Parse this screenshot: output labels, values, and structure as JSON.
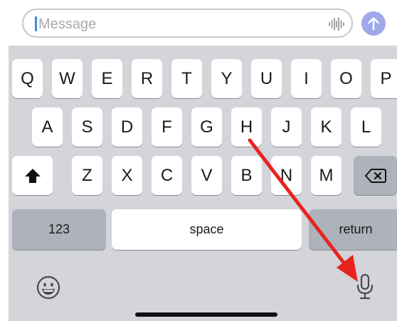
{
  "message_bar": {
    "placeholder": "Message",
    "voice_icon": "waveform-icon",
    "send_icon": "arrow-up-icon",
    "send_color": "#9ea8ea"
  },
  "keyboard": {
    "row1": [
      "Q",
      "W",
      "E",
      "R",
      "T",
      "Y",
      "U",
      "I",
      "O",
      "P"
    ],
    "row2": [
      "A",
      "S",
      "D",
      "F",
      "G",
      "H",
      "J",
      "K",
      "L"
    ],
    "row3": [
      "Z",
      "X",
      "C",
      "V",
      "B",
      "N",
      "M"
    ],
    "shift_icon": "shift-icon",
    "delete_icon": "backspace-icon",
    "numbers_label": "123",
    "space_label": "space",
    "return_label": "return",
    "emoji_icon": "emoji-icon",
    "mic_icon": "microphone-icon"
  },
  "annotation": {
    "arrow_icon": "red-arrow-icon",
    "arrow_color": "#e8231f"
  }
}
